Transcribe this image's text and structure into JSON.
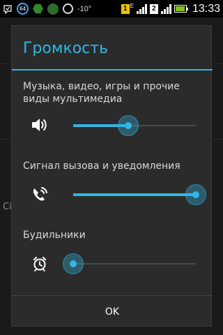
{
  "status_bar": {
    "badge_number": "64",
    "temperature": "-10°",
    "sim1_label": "1",
    "sim1_sub": "E",
    "sim2_label": "2",
    "time": "13:33",
    "battery_level": 0.9,
    "icons": [
      "notification-check-icon",
      "radio-64-icon",
      "green-hex-app-icon",
      "green-circle-app-icon",
      "sync-ring-icon"
    ]
  },
  "background": {
    "fragment": "Сі"
  },
  "dialog": {
    "title": "Громкость",
    "accent_color": "#33b5e5",
    "sections": [
      {
        "label": "Музыка, видео, игры и прочие виды мультимедиа",
        "icon": "speaker-icon",
        "value": 0.45
      },
      {
        "label": "Сигнал вызова и уведомления",
        "icon": "phone-ring-icon",
        "value": 1.0
      },
      {
        "label": "Будильники",
        "icon": "alarm-clock-icon",
        "value": 0.0
      }
    ],
    "ok_label": "OK"
  }
}
